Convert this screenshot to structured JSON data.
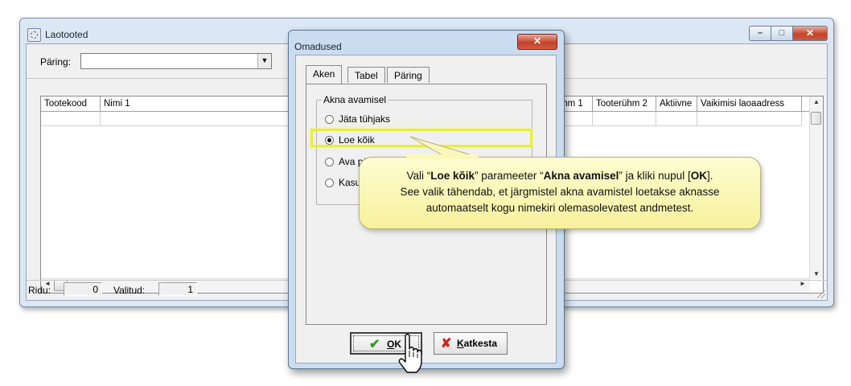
{
  "main_window": {
    "title": "Laotooted",
    "query_label": "Päring:",
    "query_value": "",
    "columns": [
      "Tootekood",
      "Nimi 1",
      "rühm 1",
      "Tooterühm 2",
      "Aktiivne",
      "Vaikimisi laoaadress"
    ],
    "status": {
      "rows_label": "Ridu:",
      "rows_value": "0",
      "selected_label": "Valitud:",
      "selected_value": "1"
    },
    "window_buttons": {
      "minimize": "–",
      "maximize": "□",
      "close": "✕"
    }
  },
  "dialog": {
    "title": "Omadused",
    "close": "✕",
    "tabs": [
      "Aken",
      "Tabel",
      "Päring"
    ],
    "active_tab": "Aken",
    "group_title": "Akna avamisel",
    "options": [
      {
        "label": "Jäta tühjaks",
        "checked": false
      },
      {
        "label": "Loe kõik",
        "checked": true
      },
      {
        "label": "Ava päringuaken",
        "checked": false
      },
      {
        "label": "Kasut",
        "checked": false
      }
    ],
    "ok_label_u": "O",
    "ok_label_rest": "K",
    "cancel_label_u": "K",
    "cancel_label_rest": "atkesta"
  },
  "callout": {
    "l1_a": "Vali “",
    "l1_b": "Loe kõik",
    "l1_c": "” parameeter “",
    "l1_d": "Akna avamisel",
    "l1_e": "” ja kliki nupul [",
    "l1_f": "OK",
    "l1_g": "].",
    "line2": "See valik tähendab, et järgmistel akna avamistel loetakse aknasse",
    "line3": "automaatselt kogu nimekiri olemasolevatest andmetest."
  },
  "colors": {
    "highlight": "#e7ef3a",
    "callout_bg": "#fcf7b4",
    "ok_check": "#2f9a1a",
    "cancel_x": "#c9261c"
  },
  "icons": [
    "app-icon",
    "combo-arrow-icon",
    "check-icon",
    "cross-icon",
    "hand-cursor-icon"
  ]
}
